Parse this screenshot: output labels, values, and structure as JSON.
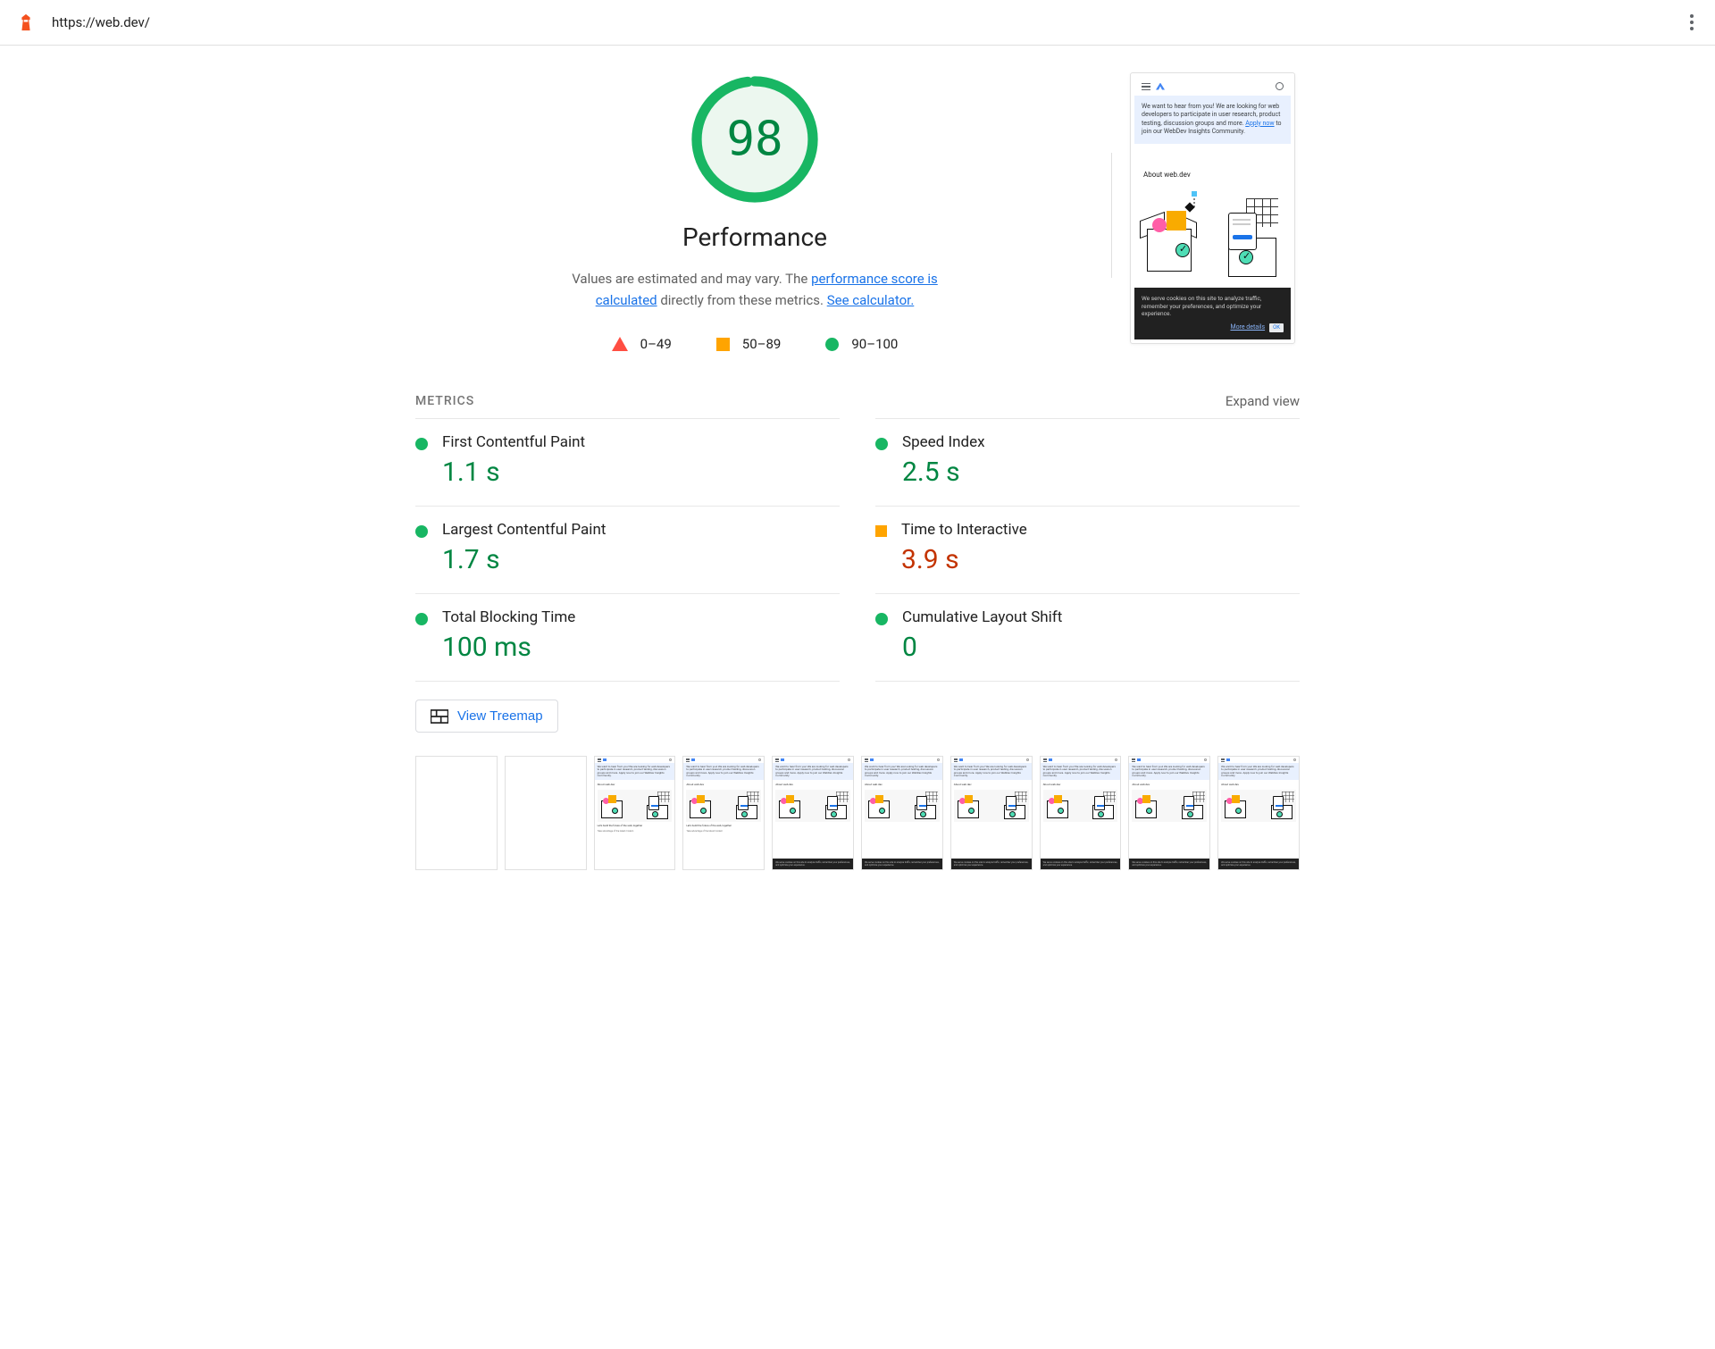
{
  "header": {
    "url": "https://web.dev/"
  },
  "gauge": {
    "score": "98",
    "category": "Performance",
    "desc_prefix": "Values are estimated and may vary. The ",
    "link1": "performance score is calculated",
    "desc_mid": " directly from these metrics. ",
    "link2": "See calculator."
  },
  "legend": {
    "fail": "0–49",
    "avg": "50–89",
    "pass": "90–100"
  },
  "preview": {
    "banner_prefix": "We want to hear from you! We are looking for web developers to participate in user research, product testing, discussion groups and more. ",
    "banner_link": "Apply now",
    "banner_suffix": " to join our WebDev Insights Community.",
    "about": "About web.dev",
    "cookies_text": "We serve cookies on this site to analyze traffic, remember your preferences, and optimize your experience.",
    "more_details": "More details",
    "ok": "OK"
  },
  "metrics": {
    "title": "METRICS",
    "expand": "Expand view",
    "items": [
      {
        "name": "First Contentful Paint",
        "value": "1.1 s",
        "status": "pass"
      },
      {
        "name": "Speed Index",
        "value": "2.5 s",
        "status": "pass"
      },
      {
        "name": "Largest Contentful Paint",
        "value": "1.7 s",
        "status": "pass"
      },
      {
        "name": "Time to Interactive",
        "value": "3.9 s",
        "status": "avg"
      },
      {
        "name": "Total Blocking Time",
        "value": "100 ms",
        "status": "pass"
      },
      {
        "name": "Cumulative Layout Shift",
        "value": "0",
        "status": "pass"
      }
    ]
  },
  "treemap": {
    "label": "View Treemap"
  },
  "thumb": {
    "banner": "We want to hear from you! We are looking for web developers to participate in user research, product testing, discussion groups and more. Apply now to join our WebDev Insights Community.",
    "about": "About web.dev",
    "footer_title": "Let's build the future of the web, together",
    "footer_sub": "Take advantage of the latest modern",
    "cookies": "We serve cookies on this site to analyze traffic, remember your preferences, and optimize your experience."
  },
  "filmstrip_variants": [
    "blank",
    "blank",
    "v1",
    "v1",
    "v2",
    "v2",
    "v2",
    "v2",
    "v2",
    "v2"
  ]
}
